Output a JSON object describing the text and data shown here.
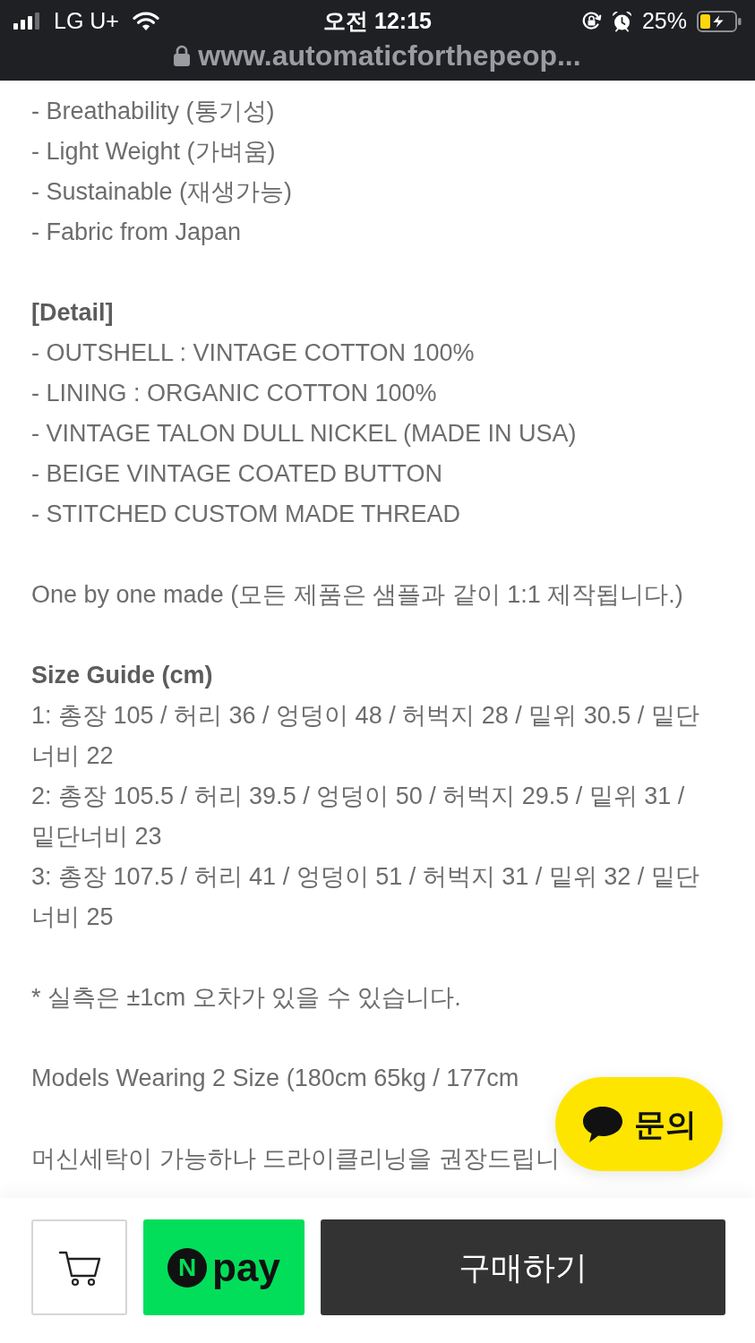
{
  "status_bar": {
    "carrier": "LG U+",
    "time": "오전 12:15",
    "battery_percent": "25%"
  },
  "address_bar": {
    "url": "www.automaticforthepeop..."
  },
  "features": [
    "- Breathability (통기성)",
    "- Light Weight (가벼움)",
    "- Sustainable (재생가능)",
    "- Fabric from Japan"
  ],
  "detail": {
    "title": "[Detail]",
    "items": [
      "- OUTSHELL : VINTAGE COTTON 100%",
      "- LINING : ORGANIC COTTON 100%",
      "- VINTAGE TALON DULL NICKEL (MADE IN USA)",
      "- BEIGE VINTAGE COATED BUTTON",
      "- STITCHED CUSTOM MADE THREAD"
    ]
  },
  "note": "One by one made (모든 제품은 샘플과 같이 1:1 제작됩니다.)",
  "size_guide": {
    "title": "Size Guide (cm)",
    "rows": [
      "1: 총장 105 / 허리 36 / 엉덩이 48 / 허벅지 28 / 밑위 30.5 / 밑단너비 22",
      "2: 총장 105.5 / 허리 39.5 / 엉덩이 50 / 허벅지 29.5 / 밑위 31 / 밑단너비 23",
      "3: 총장 107.5 / 허리 41 / 엉덩이 51 / 허벅지 31 / 밑위 32 / 밑단너비 25"
    ]
  },
  "tolerance_note": "* 실측은 ±1cm 오차가 있을 수 있습니다.",
  "models_note": "Models Wearing 2 Size (180cm 65kg / 177cm",
  "care_note": "머신세탁이 가능하나 드라이클리닝을 권장드립니",
  "chat_button": {
    "label": "문의"
  },
  "bottom_bar": {
    "npay": {
      "badge": "N",
      "label": "pay"
    },
    "buy_button": {
      "label": "구매하기"
    }
  }
}
